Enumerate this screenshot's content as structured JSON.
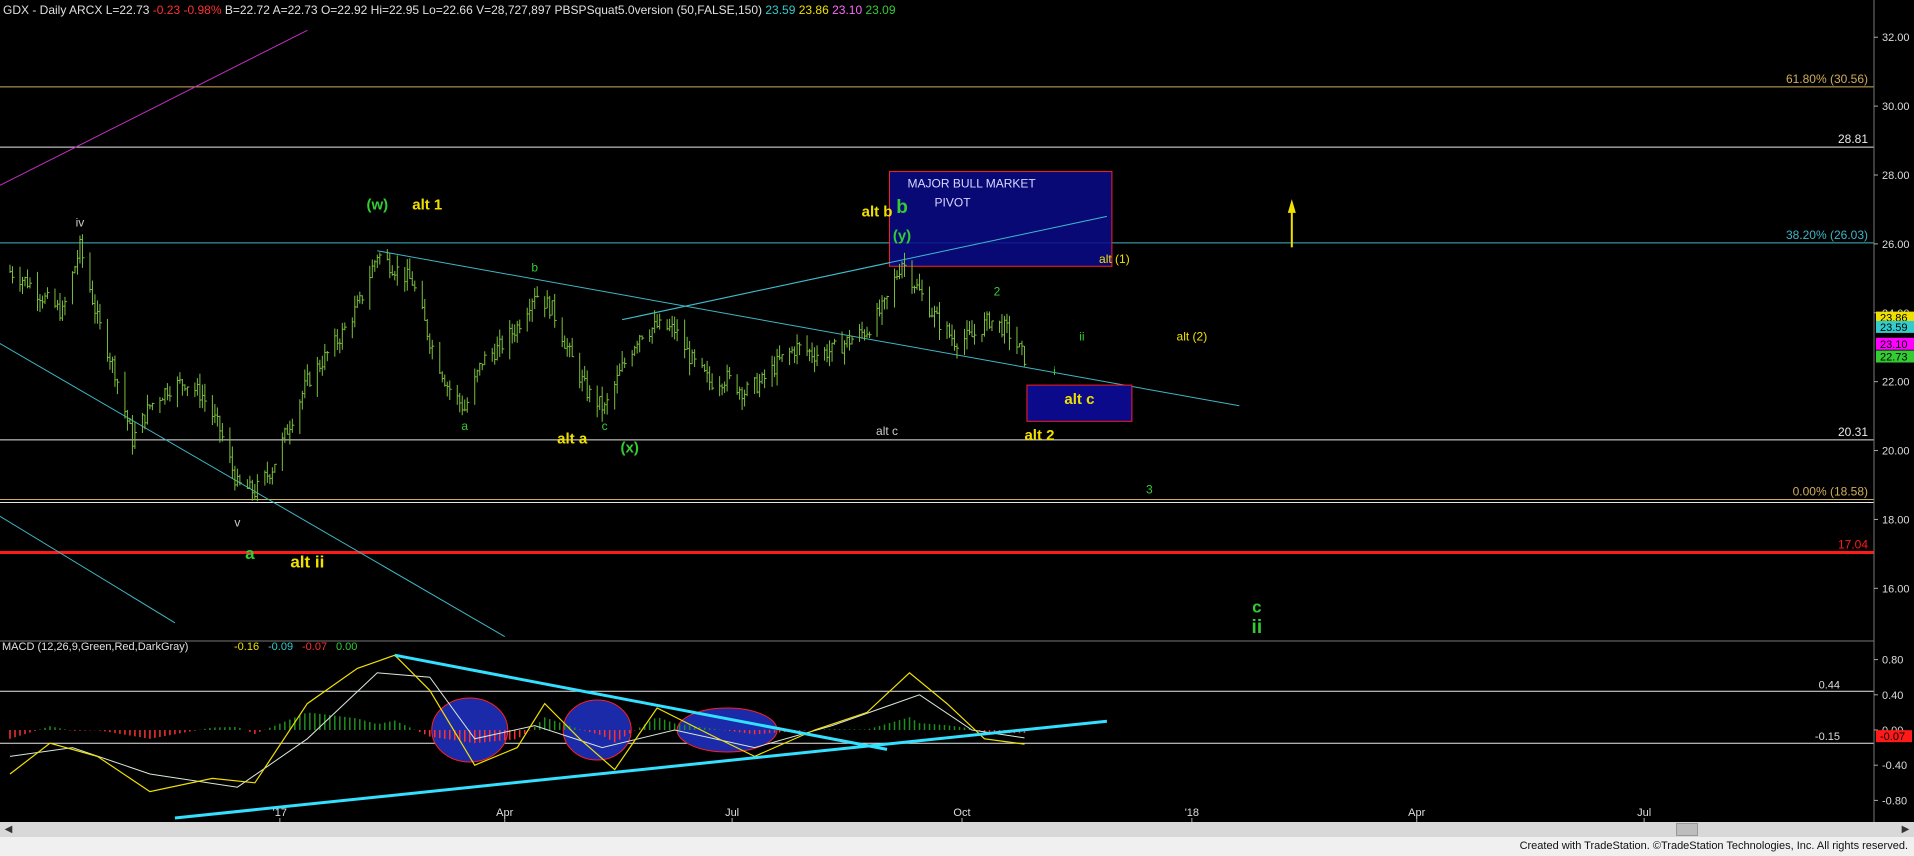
{
  "header": {
    "symbol": "GDX - Daily",
    "exchange": "ARCX",
    "last": "L=22.73",
    "change": "-0.23",
    "change_pct": "-0.98%",
    "bid": "B=22.72",
    "ask": "A=22.73",
    "open": "O=22.92",
    "high": "Hi=22.95",
    "low": "Lo=22.66",
    "volume": "V=28,727,897",
    "indicator": "PBSPSquat5.0version (50,FALSE,150)",
    "ind_v1": "23.59",
    "ind_v2": "23.86",
    "ind_v3": "23.10",
    "ind_v4": "23.09"
  },
  "colors": {
    "background": "#000000",
    "price_bars": "#7cbf3c",
    "trendline": "#3fb6c6",
    "support_line": "#e8e8e8",
    "red_line": "#ff1a1a",
    "yellow_label": "#f0e000",
    "green_label": "#33cc33",
    "pivot_box": "#0a0a8a",
    "macd_line": "#f0e000",
    "signal_line": "#d8e8d8",
    "hist_pos": "#1e8f1e",
    "hist_neg": "#ff3030",
    "oval_fill": "#1a2aa8"
  },
  "chart_data": [
    {
      "type": "ohlc",
      "title": "GDX - Daily",
      "ylim": [
        14.5,
        32.5
      ],
      "y_ticks": [
        "32.00",
        "30.00",
        "28.00",
        "26.00",
        "24.00",
        "22.00",
        "20.00",
        "18.00",
        "16.00"
      ],
      "x_ticks": [
        "'17",
        "Apr",
        "Jul",
        "Oct",
        "'18",
        "Apr",
        "Jul"
      ],
      "close_path": [
        [
          "2016-09-15",
          25.2
        ],
        [
          "2016-09-22",
          24.9
        ],
        [
          "2016-09-29",
          24.4
        ],
        [
          "2016-10-06",
          24.0
        ],
        [
          "2016-10-13",
          25.9
        ],
        [
          "2016-10-20",
          23.8
        ],
        [
          "2016-10-27",
          22.3
        ],
        [
          "2016-11-03",
          20.3
        ],
        [
          "2016-11-10",
          21.3
        ],
        [
          "2016-11-17",
          21.8
        ],
        [
          "2016-11-24",
          22.0
        ],
        [
          "2016-12-01",
          21.6
        ],
        [
          "2016-12-08",
          20.6
        ],
        [
          "2016-12-15",
          19.0
        ],
        [
          "2016-12-22",
          18.8
        ],
        [
          "2016-12-29",
          19.5
        ],
        [
          "2017-01-05",
          20.8
        ],
        [
          "2017-01-12",
          22.0
        ],
        [
          "2017-01-19",
          22.7
        ],
        [
          "2017-01-26",
          23.4
        ],
        [
          "2017-02-02",
          24.3
        ],
        [
          "2017-02-09",
          25.7
        ],
        [
          "2017-02-16",
          25.3
        ],
        [
          "2017-02-23",
          24.9
        ],
        [
          "2017-03-02",
          23.2
        ],
        [
          "2017-03-09",
          21.9
        ],
        [
          "2017-03-16",
          21.2
        ],
        [
          "2017-03-23",
          22.6
        ],
        [
          "2017-03-30",
          23.0
        ],
        [
          "2017-04-06",
          23.6
        ],
        [
          "2017-04-13",
          24.6
        ],
        [
          "2017-04-20",
          24.1
        ],
        [
          "2017-04-27",
          22.8
        ],
        [
          "2017-05-04",
          21.7
        ],
        [
          "2017-05-11",
          21.2
        ],
        [
          "2017-05-18",
          22.4
        ],
        [
          "2017-05-25",
          23.4
        ],
        [
          "2017-06-01",
          23.6
        ],
        [
          "2017-06-08",
          23.5
        ],
        [
          "2017-06-15",
          22.6
        ],
        [
          "2017-06-22",
          22.0
        ],
        [
          "2017-06-29",
          22.1
        ],
        [
          "2017-07-06",
          21.7
        ],
        [
          "2017-07-13",
          22.0
        ],
        [
          "2017-07-20",
          22.6
        ],
        [
          "2017-07-27",
          23.0
        ],
        [
          "2017-08-03",
          22.8
        ],
        [
          "2017-08-10",
          22.9
        ],
        [
          "2017-08-17",
          23.2
        ],
        [
          "2017-08-24",
          23.5
        ],
        [
          "2017-08-31",
          24.2
        ],
        [
          "2017-09-07",
          25.5
        ],
        [
          "2017-09-14",
          24.6
        ],
        [
          "2017-09-21",
          23.8
        ],
        [
          "2017-09-28",
          23.2
        ],
        [
          "2017-10-05",
          23.3
        ],
        [
          "2017-10-12",
          23.8
        ],
        [
          "2017-10-19",
          23.5
        ],
        [
          "2017-10-26",
          22.7
        ]
      ],
      "horizontal_levels": [
        {
          "value": 30.56,
          "label": "61.80% (30.56)",
          "color": "#cfae5a"
        },
        {
          "value": 28.81,
          "label": "28.81",
          "color": "#e8e8e8"
        },
        {
          "value": 26.03,
          "label": "38.20% (26.03)",
          "color": "#3fb6c6"
        },
        {
          "value": 20.31,
          "label": "20.31",
          "color": "#e8e8e8"
        },
        {
          "value": 18.58,
          "label": "0.00% (18.58)",
          "color": "#cfae5a"
        },
        {
          "value": 17.04,
          "label": "17.04",
          "color": "#ff1a1a"
        }
      ],
      "right_axis_markers": [
        {
          "value": 23.86,
          "label": "23.86",
          "bg": "#f0e000",
          "fg": "#000"
        },
        {
          "value": 23.59,
          "label": "23.59",
          "bg": "#33cccc",
          "fg": "#000"
        },
        {
          "value": 23.1,
          "label": "23.10",
          "bg": "#ff00ff",
          "fg": "#000"
        },
        {
          "value": 22.73,
          "label": "22.73",
          "bg": "#33cc33",
          "fg": "#000"
        }
      ],
      "annotations": {
        "pivot_title": "MAJOR BULL MARKET",
        "pivot_sub": "PIVOT",
        "alt_c_box": "alt c",
        "wave_labels": [
          {
            "text": "(w)",
            "color": "#33cc33",
            "date": "2017-02-09",
            "value": 27.0,
            "size": 15
          },
          {
            "text": "alt 1",
            "color": "#f0e000",
            "date": "2017-03-01",
            "value": 27.0,
            "size": 15
          },
          {
            "text": "iv",
            "color": "#cccccc",
            "date": "2016-10-13",
            "value": 26.5,
            "size": 12
          },
          {
            "text": "b",
            "color": "#33cc33",
            "date": "2017-04-13",
            "value": 25.2,
            "size": 12
          },
          {
            "text": "a",
            "color": "#33cc33",
            "date": "2017-03-16",
            "value": 20.6,
            "size": 12
          },
          {
            "text": "c",
            "color": "#33cc33",
            "date": "2017-05-11",
            "value": 20.6,
            "size": 12
          },
          {
            "text": "alt a",
            "color": "#f0e000",
            "date": "2017-04-28",
            "value": 20.2,
            "size": 15
          },
          {
            "text": "(x)",
            "color": "#33cc33",
            "date": "2017-05-21",
            "value": 19.95,
            "size": 15
          },
          {
            "text": "alt b",
            "color": "#f0e000",
            "date": "2017-08-28",
            "value": 26.8,
            "size": 15
          },
          {
            "text": "b",
            "color": "#33cc33",
            "date": "2017-09-07",
            "value": 26.9,
            "size": 19
          },
          {
            "text": "(y)",
            "color": "#33cc33",
            "date": "2017-09-07",
            "value": 26.1,
            "size": 15
          },
          {
            "text": "alt c",
            "color": "#cccccc",
            "date": "2017-09-01",
            "value": 20.45,
            "size": 12
          },
          {
            "text": "2",
            "color": "#33cc33",
            "date": "2017-10-15",
            "value": 24.5,
            "size": 12
          },
          {
            "text": "i",
            "color": "#33cc33",
            "date": "2017-11-07",
            "value": 22.2,
            "size": 12
          },
          {
            "text": "ii",
            "color": "#33cc33",
            "date": "2017-11-18",
            "value": 23.2,
            "size": 12
          },
          {
            "text": "alt (1)",
            "color": "#f0e000",
            "date": "2017-12-01",
            "value": 25.45,
            "size": 12
          },
          {
            "text": "alt (2)",
            "color": "#f0e000",
            "date": "2018-01-01",
            "value": 23.2,
            "size": 12
          },
          {
            "text": "alt 2",
            "color": "#f0e000",
            "date": "2017-11-01",
            "value": 20.3,
            "size": 15
          },
          {
            "text": "3",
            "color": "#33cc33",
            "date": "2017-12-15",
            "value": 18.75,
            "size": 12
          },
          {
            "text": "v",
            "color": "#cccccc",
            "date": "2016-12-15",
            "value": 17.8,
            "size": 12
          },
          {
            "text": "a",
            "color": "#33cc33",
            "date": "2016-12-20",
            "value": 16.85,
            "size": 17
          },
          {
            "text": "alt ii",
            "color": "#f0e000",
            "date": "2017-01-12",
            "value": 16.6,
            "size": 17
          },
          {
            "text": "c",
            "color": "#33cc33",
            "date": "2018-01-27",
            "value": 15.3,
            "size": 17
          },
          {
            "text": "ii",
            "color": "#33cc33",
            "date": "2018-01-27",
            "value": 14.7,
            "size": 19
          }
        ]
      }
    },
    {
      "type": "macd",
      "title": "MACD (12,26,9,Green,Red,DarkGray)",
      "values": [
        "-0.16",
        "-0.09",
        "-0.07",
        "0.00"
      ],
      "ylim": [
        -1.0,
        1.0
      ],
      "y_ticks": [
        "0.80",
        "0.40",
        "0.00",
        "-0.40",
        "-0.80"
      ],
      "levels": [
        {
          "value": 0.44,
          "label": "0.44"
        },
        {
          "value": -0.15,
          "label": "-0.15"
        }
      ],
      "right_axis_marker": {
        "value": -0.07,
        "label": "-0.07",
        "bg": "#ff1a1a",
        "fg": "#000"
      },
      "macd_path": [
        [
          "2016-09-15",
          -0.5
        ],
        [
          "2016-10-01",
          -0.15
        ],
        [
          "2016-10-20",
          -0.3
        ],
        [
          "2016-11-10",
          -0.7
        ],
        [
          "2016-12-05",
          -0.55
        ],
        [
          "2016-12-22",
          -0.6
        ],
        [
          "2017-01-12",
          0.3
        ],
        [
          "2017-02-01",
          0.7
        ],
        [
          "2017-02-16",
          0.85
        ],
        [
          "2017-03-02",
          0.45
        ],
        [
          "2017-03-20",
          -0.4
        ],
        [
          "2017-04-06",
          -0.2
        ],
        [
          "2017-04-17",
          0.3
        ],
        [
          "2017-05-01",
          -0.1
        ],
        [
          "2017-05-15",
          -0.45
        ],
        [
          "2017-06-01",
          0.25
        ],
        [
          "2017-06-22",
          -0.05
        ],
        [
          "2017-07-10",
          -0.3
        ],
        [
          "2017-08-03",
          0.0
        ],
        [
          "2017-08-24",
          0.2
        ],
        [
          "2017-09-10",
          0.65
        ],
        [
          "2017-09-25",
          0.3
        ],
        [
          "2017-10-10",
          -0.1
        ],
        [
          "2017-10-26",
          -0.16
        ]
      ],
      "signal_path": [
        [
          "2016-09-15",
          -0.3
        ],
        [
          "2016-10-10",
          -0.2
        ],
        [
          "2016-11-10",
          -0.5
        ],
        [
          "2016-12-15",
          -0.65
        ],
        [
          "2017-01-12",
          -0.1
        ],
        [
          "2017-02-09",
          0.65
        ],
        [
          "2017-03-02",
          0.6
        ],
        [
          "2017-03-20",
          -0.1
        ],
        [
          "2017-04-13",
          0.05
        ],
        [
          "2017-05-10",
          -0.2
        ],
        [
          "2017-06-08",
          0.0
        ],
        [
          "2017-07-10",
          -0.2
        ],
        [
          "2017-08-10",
          0.05
        ],
        [
          "2017-09-14",
          0.4
        ],
        [
          "2017-10-05",
          0.0
        ],
        [
          "2017-10-26",
          -0.09
        ]
      ]
    }
  ],
  "footer": {
    "credit": "Created with TradeStation. ©TradeStation Technologies, Inc. All rights reserved."
  }
}
